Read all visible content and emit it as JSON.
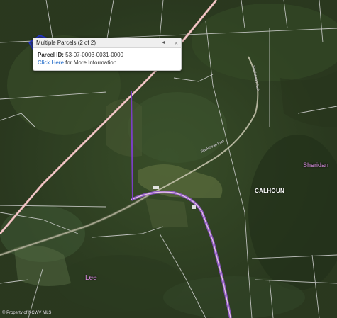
{
  "popup": {
    "title": "Multiple Parcels (2 of 2)",
    "nav_glyph": "◄",
    "close_glyph": "×",
    "parcel_label": "Parcel ID:",
    "parcel_id": "53-07-0003-0031-0000",
    "link_text": "Click Here",
    "link_suffix": " for More Information"
  },
  "labels": {
    "sheridan": "Sheridan",
    "calhoun": "CALHOUN",
    "lee": "Lee"
  },
  "roads": {
    "road_1": "Blackthean Park",
    "road_2": "Blackthean Park"
  },
  "copyright": "© Property of NCWV MLS",
  "colors": {
    "parcel_outline": "#7b3fc4",
    "highlighted_parcel": "#2233cc",
    "major_road": "#e8b2b2",
    "boundary_line": "#d8d8d8",
    "selected_route": "#9b59d9"
  }
}
